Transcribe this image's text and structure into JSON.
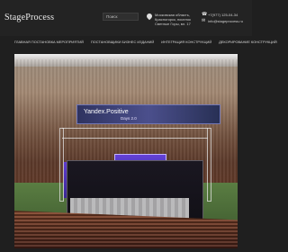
{
  "header": {
    "logo_text": "StageProcess",
    "logo_subtitle": "",
    "search_label": "Поиск",
    "address": "Московская область, Красногорск, поселок Светлые Горы, вл. 17",
    "phone": "+7(977) 125-04-34",
    "email": "info@stageprocess.ru"
  },
  "nav": {
    "items": [
      "ГЛАВНАЯ ПОСТАНОВКА МЕРОПРИЯТИЙ",
      "ПОСТАНОВЩИКИ БИЗНЕС ИЗДАНИЙ",
      "ИНТЕГРАЦИЯ КОНСТРУКЦИЙ",
      "ДЕКОРИРОВАНИЕ КОНСТРУКЦИЙ"
    ]
  },
  "hero": {
    "screen_title": "Yandex.Positive",
    "screen_subtitle": "Days 2.0"
  },
  "colors": {
    "background": "#1f1f1f",
    "topbar": "#232323",
    "accent": "#4b4f8c"
  },
  "icons": {
    "location": "map-pin-icon",
    "phone": "phone-icon",
    "email": "email-icon"
  }
}
